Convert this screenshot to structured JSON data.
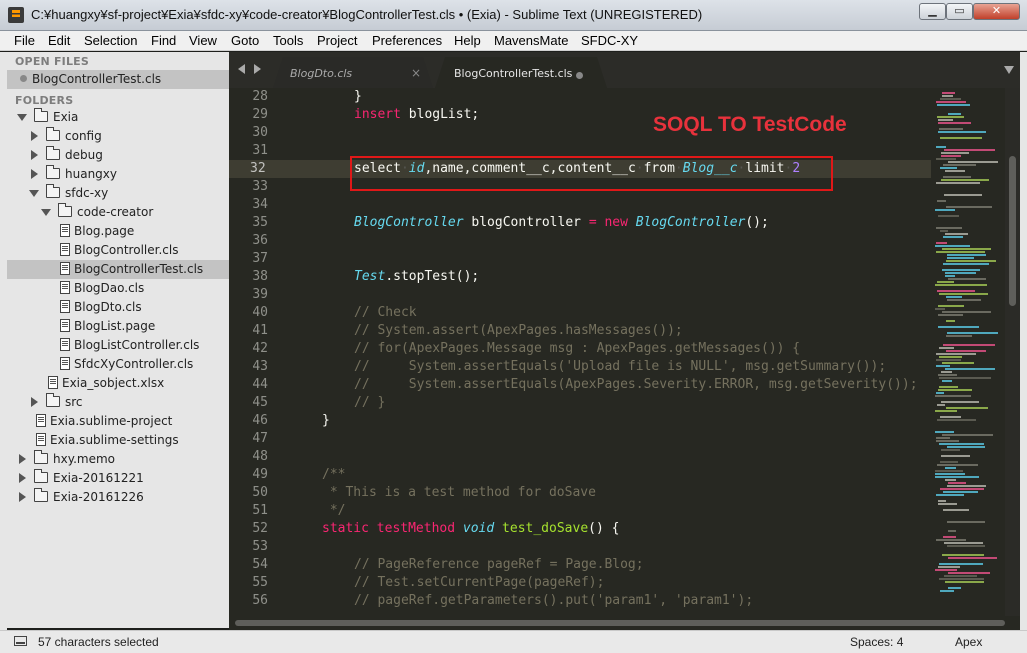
{
  "window": {
    "title": "C:¥huangxy¥sf-project¥Exia¥sfdc-xy¥code-creator¥BlogControllerTest.cls • (Exia) - Sublime Text (UNREGISTERED)",
    "min_glyph": "▁",
    "max_glyph": "▭",
    "close_glyph": "✕"
  },
  "menu": [
    "File",
    "Edit",
    "Selection",
    "Find",
    "View",
    "Goto",
    "Tools",
    "Project",
    "Preferences",
    "Help",
    "MavensMate",
    "SFDC-XY"
  ],
  "sidebar": {
    "open_files_header": "OPEN FILES",
    "open_files": [
      "BlogControllerTest.cls"
    ],
    "folders_header": "FOLDERS",
    "tree": [
      {
        "label": "Exia",
        "kind": "folder",
        "expanded": true,
        "depth": 0
      },
      {
        "label": "config",
        "kind": "folder",
        "expanded": false,
        "depth": 1
      },
      {
        "label": "debug",
        "kind": "folder",
        "expanded": false,
        "depth": 1
      },
      {
        "label": "huangxy",
        "kind": "folder",
        "expanded": false,
        "depth": 1
      },
      {
        "label": "sfdc-xy",
        "kind": "folder",
        "expanded": true,
        "depth": 1
      },
      {
        "label": "code-creator",
        "kind": "folder",
        "expanded": true,
        "depth": 2
      },
      {
        "label": "Blog.page",
        "kind": "file",
        "depth": 3
      },
      {
        "label": "BlogController.cls",
        "kind": "file",
        "depth": 3
      },
      {
        "label": "BlogControllerTest.cls",
        "kind": "file",
        "depth": 3,
        "selected": true
      },
      {
        "label": "BlogDao.cls",
        "kind": "file",
        "depth": 3
      },
      {
        "label": "BlogDto.cls",
        "kind": "file",
        "depth": 3
      },
      {
        "label": "BlogList.page",
        "kind": "file",
        "depth": 3
      },
      {
        "label": "BlogListController.cls",
        "kind": "file",
        "depth": 3
      },
      {
        "label": "SfdcXyController.cls",
        "kind": "file",
        "depth": 3
      },
      {
        "label": "Exia_sobject.xlsx",
        "kind": "file",
        "depth": 2
      },
      {
        "label": "src",
        "kind": "folder",
        "expanded": false,
        "depth": 1
      },
      {
        "label": "Exia.sublime-project",
        "kind": "file",
        "depth": 1
      },
      {
        "label": "Exia.sublime-settings",
        "kind": "file",
        "depth": 1
      },
      {
        "label": "hxy.memo",
        "kind": "folder",
        "expanded": false,
        "depth": 0
      },
      {
        "label": "Exia-20161221",
        "kind": "folder",
        "expanded": false,
        "depth": 0
      },
      {
        "label": "Exia-20161226",
        "kind": "folder",
        "expanded": false,
        "depth": 0
      }
    ]
  },
  "tabs": [
    {
      "label": "BlogDto.cls",
      "active": false,
      "close": "×"
    },
    {
      "label": "BlogControllerTest.cls",
      "active": true,
      "dirty": true
    }
  ],
  "editor": {
    "current_line": 32,
    "lines": [
      {
        "n": "28",
        "tokens": [
          [
            "plain",
            "}"
          ]
        ]
      },
      {
        "n": "29",
        "tokens": [
          [
            "kw",
            "insert"
          ],
          [
            "plain",
            " blogList;"
          ]
        ]
      },
      {
        "n": "30",
        "tokens": []
      },
      {
        "n": "31",
        "tokens": []
      },
      {
        "n": "32",
        "tokens": [
          [
            "plain",
            "select"
          ],
          [
            "ws",
            "·"
          ],
          [
            "ty",
            "id"
          ],
          [
            "plain",
            ",name,comment__c,content__c"
          ],
          [
            "ws",
            "·"
          ],
          [
            "plain",
            "from"
          ],
          [
            "ws",
            "·"
          ],
          [
            "ty",
            "Blog__c"
          ],
          [
            "ws",
            "·"
          ],
          [
            "plain",
            "limit"
          ],
          [
            "ws",
            "·"
          ],
          [
            "num",
            "2"
          ]
        ]
      },
      {
        "n": "33",
        "tokens": []
      },
      {
        "n": "34",
        "tokens": []
      },
      {
        "n": "35",
        "tokens": [
          [
            "ty",
            "BlogController"
          ],
          [
            "plain",
            " blogController "
          ],
          [
            "kw",
            "="
          ],
          [
            "plain",
            " "
          ],
          [
            "kw",
            "new"
          ],
          [
            "plain",
            " "
          ],
          [
            "ty",
            "BlogController"
          ],
          [
            "plain",
            "();"
          ]
        ]
      },
      {
        "n": "36",
        "tokens": []
      },
      {
        "n": "37",
        "tokens": []
      },
      {
        "n": "38",
        "tokens": [
          [
            "ty",
            "Test"
          ],
          [
            "plain",
            ".stopTest();"
          ]
        ]
      },
      {
        "n": "39",
        "tokens": []
      },
      {
        "n": "40",
        "tokens": [
          [
            "cm",
            "// Check"
          ]
        ]
      },
      {
        "n": "41",
        "tokens": [
          [
            "cm",
            "// System.assert(ApexPages.hasMessages());"
          ]
        ]
      },
      {
        "n": "42",
        "tokens": [
          [
            "cm",
            "// for(ApexPages.Message msg : ApexPages.getMessages()) {"
          ]
        ]
      },
      {
        "n": "43",
        "tokens": [
          [
            "cm",
            "//     System.assertEquals('Upload file is NULL', msg.getSummary());"
          ]
        ]
      },
      {
        "n": "44",
        "tokens": [
          [
            "cm",
            "//     System.assertEquals(ApexPages.Severity.ERROR, msg.getSeverity());"
          ]
        ]
      },
      {
        "n": "45",
        "tokens": [
          [
            "cm",
            "// }"
          ]
        ]
      },
      {
        "n": "46",
        "tokens": [
          [
            "plain",
            "}"
          ]
        ]
      },
      {
        "n": "47",
        "tokens": []
      },
      {
        "n": "48",
        "tokens": []
      },
      {
        "n": "49",
        "tokens": [
          [
            "cm",
            "/**"
          ]
        ]
      },
      {
        "n": "50",
        "tokens": [
          [
            "cm",
            " * This is a test method for doSave"
          ]
        ]
      },
      {
        "n": "51",
        "tokens": [
          [
            "cm",
            " */"
          ]
        ]
      },
      {
        "n": "52",
        "tokens": [
          [
            "kw",
            "static"
          ],
          [
            "plain",
            " "
          ],
          [
            "kw",
            "testMethod"
          ],
          [
            "plain",
            " "
          ],
          [
            "ty",
            "void"
          ],
          [
            "plain",
            " "
          ],
          [
            "fn",
            "test_doSave"
          ],
          [
            "plain",
            "() {"
          ]
        ]
      },
      {
        "n": "53",
        "tokens": []
      },
      {
        "n": "54",
        "tokens": [
          [
            "cm",
            "// PageReference pageRef = Page.Blog;"
          ]
        ]
      },
      {
        "n": "55",
        "tokens": [
          [
            "cm",
            "// Test.setCurrentPage(pageRef);"
          ]
        ]
      },
      {
        "n": "56",
        "tokens": [
          [
            "cm",
            "// pageRef.getParameters().put('param1', 'param1');"
          ]
        ]
      }
    ]
  },
  "annotation": "SOQL TO TestCode",
  "status": {
    "selection": "57 characters selected",
    "spaces": "Spaces: 4",
    "syntax": "Apex"
  },
  "colors": {
    "keyword": "#f92672",
    "type": "#66d9ef",
    "function": "#a6e22e",
    "comment": "#75715e",
    "number": "#ae81ff",
    "annotation": "#e8323c",
    "highlight_box": "#e01818"
  }
}
